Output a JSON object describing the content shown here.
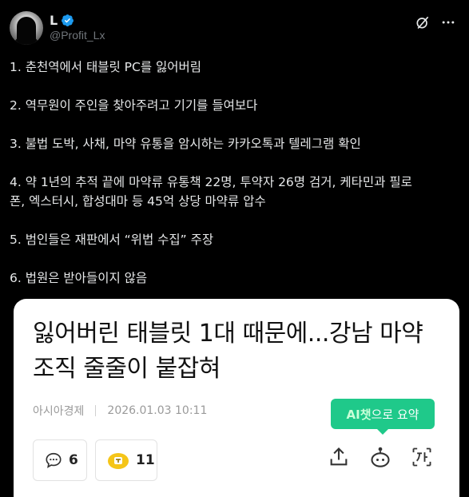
{
  "tweet": {
    "author_name": "L",
    "handle": "@Profit_Lx",
    "lines": [
      "1. 춘천역에서 태블릿 PC를 잃어버림",
      "2. 역무원이 주인을 찾아주려고 기기를 들여보다",
      "3. 불법 도박, 사채, 마약 유통을 암시하는 카카오톡과 텔레그램 확인",
      "4. 약 1년의 추적 끝에 마약류 유통책 22명, 투약자 26명 검거, 케타민과 필로",
      "폰, 엑스터시, 합성대마 등 45억 상당 마약류 압수",
      "5. 범인들은 재판에서 “위법 수집” 주장",
      "6. 법원은 받아들이지 않음"
    ]
  },
  "card": {
    "title": "잃어버린 태블릿 1대 때문에...강남 마약조직 줄줄이 붙잡혀",
    "source": "아시아경제",
    "datetime": "2026.01.03 10:11",
    "ai_badge_highlight": "AI챗",
    "ai_badge_rest": "으로 요약",
    "comment_count": "6",
    "like_count": "11"
  },
  "icons": {
    "verified": "verified-badge-icon",
    "grok": "grok-icon",
    "more": "more-icon",
    "comment": "comment-bubble-icon",
    "like": "like-emoji-icon",
    "share": "share-icon",
    "bot": "ai-bot-icon",
    "font": "font-size-icon"
  },
  "colors": {
    "background": "#000000",
    "text": "#e7e9ea",
    "muted": "#71767b",
    "verified": "#1d9bf0",
    "ai_green": "#1fc98a"
  }
}
